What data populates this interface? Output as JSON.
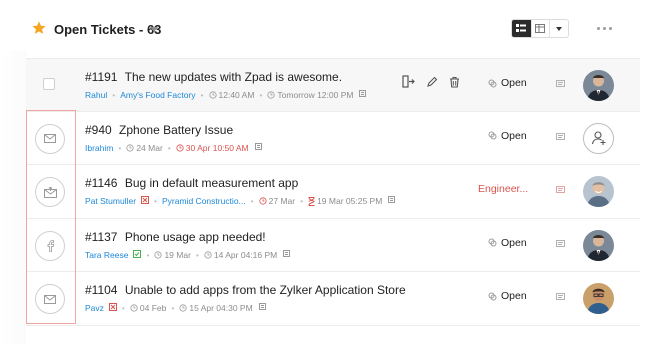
{
  "header": {
    "title": "Open Tickets - 63",
    "star_color": "#f5a623"
  },
  "tickets": [
    {
      "id": "#1191",
      "subject": "The new updates with Zpad is awesome.",
      "contact": "Rahul",
      "account": "Amy's Food Factory",
      "created": "12:40 AM",
      "due": "Tomorrow 12:00 PM",
      "due_overdue": false,
      "status": "Open",
      "channel": "none",
      "avatar": "avatar-man-suit",
      "selected": true
    },
    {
      "id": "#940",
      "subject": "Zphone Battery Issue",
      "contact": "Ibrahim",
      "account": "",
      "created": "24 Mar",
      "due": "30 Apr 10:50 AM",
      "due_overdue": true,
      "status": "Open",
      "channel": "email-icon",
      "avatar": "add-assignee"
    },
    {
      "id": "#1146",
      "subject": "Bug in default measurement app",
      "contact": "Pat Stumuller",
      "account": "Pyramid Constructio...",
      "created": "27 Mar",
      "due": "19 Mar 05:25 PM",
      "due_overdue": true,
      "status": "Engineer...",
      "status_color": "#d9534f",
      "channel": "email-reply-icon",
      "avatar": "avatar-man-smile"
    },
    {
      "id": "#1137",
      "subject": "Phone usage app needed!",
      "contact": "Tara Reese",
      "account": "",
      "created": "19 Mar",
      "due": "14 Apr 04:16 PM",
      "due_overdue": false,
      "status": "Open",
      "channel": "facebook-icon",
      "avatar": "avatar-man-suit"
    },
    {
      "id": "#1104",
      "subject": "Unable to add apps from the Zylker Application Store",
      "contact": "Pavz",
      "account": "",
      "created": "04 Feb",
      "due": "15 Apr 04:30 PM",
      "due_overdue": false,
      "status": "Open",
      "channel": "email-icon",
      "avatar": "avatar-man-glasses"
    }
  ],
  "colors": {
    "link": "#1e88d9",
    "overdue": "#d9534f",
    "highlight_border": "#f2a5a2"
  }
}
